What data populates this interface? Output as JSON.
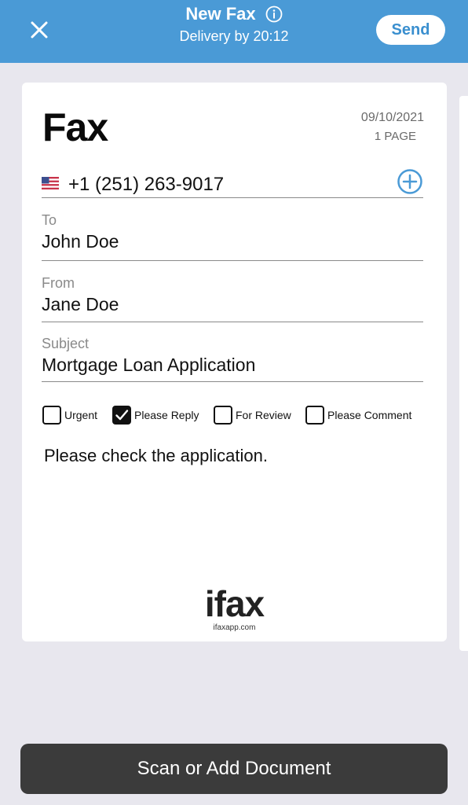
{
  "header": {
    "title": "New Fax",
    "subtitle": "Delivery by 20:12",
    "send_label": "Send",
    "background_color": "#4a9ad6"
  },
  "cover": {
    "heading": "Fax",
    "date": "09/10/2021",
    "pages": "1 PAGE",
    "phone": {
      "country_flag": "us-flag-icon",
      "number": "+1 (251) 263-9017"
    },
    "fields": {
      "to": {
        "label": "To",
        "value": "John Doe"
      },
      "from": {
        "label": "From",
        "value": "Jane Doe"
      },
      "subject": {
        "label": "Subject",
        "value": "Mortgage Loan Application"
      }
    },
    "checkboxes": [
      {
        "label": "Urgent",
        "checked": false
      },
      {
        "label": "Please Reply",
        "checked": true
      },
      {
        "label": "For Review",
        "checked": false
      },
      {
        "label": "Please Comment",
        "checked": false
      }
    ],
    "message": "Please check the application.",
    "logo": {
      "word": "ifax",
      "url": "ifaxapp.com"
    }
  },
  "actions": {
    "scan_label": "Scan or Add Document"
  }
}
